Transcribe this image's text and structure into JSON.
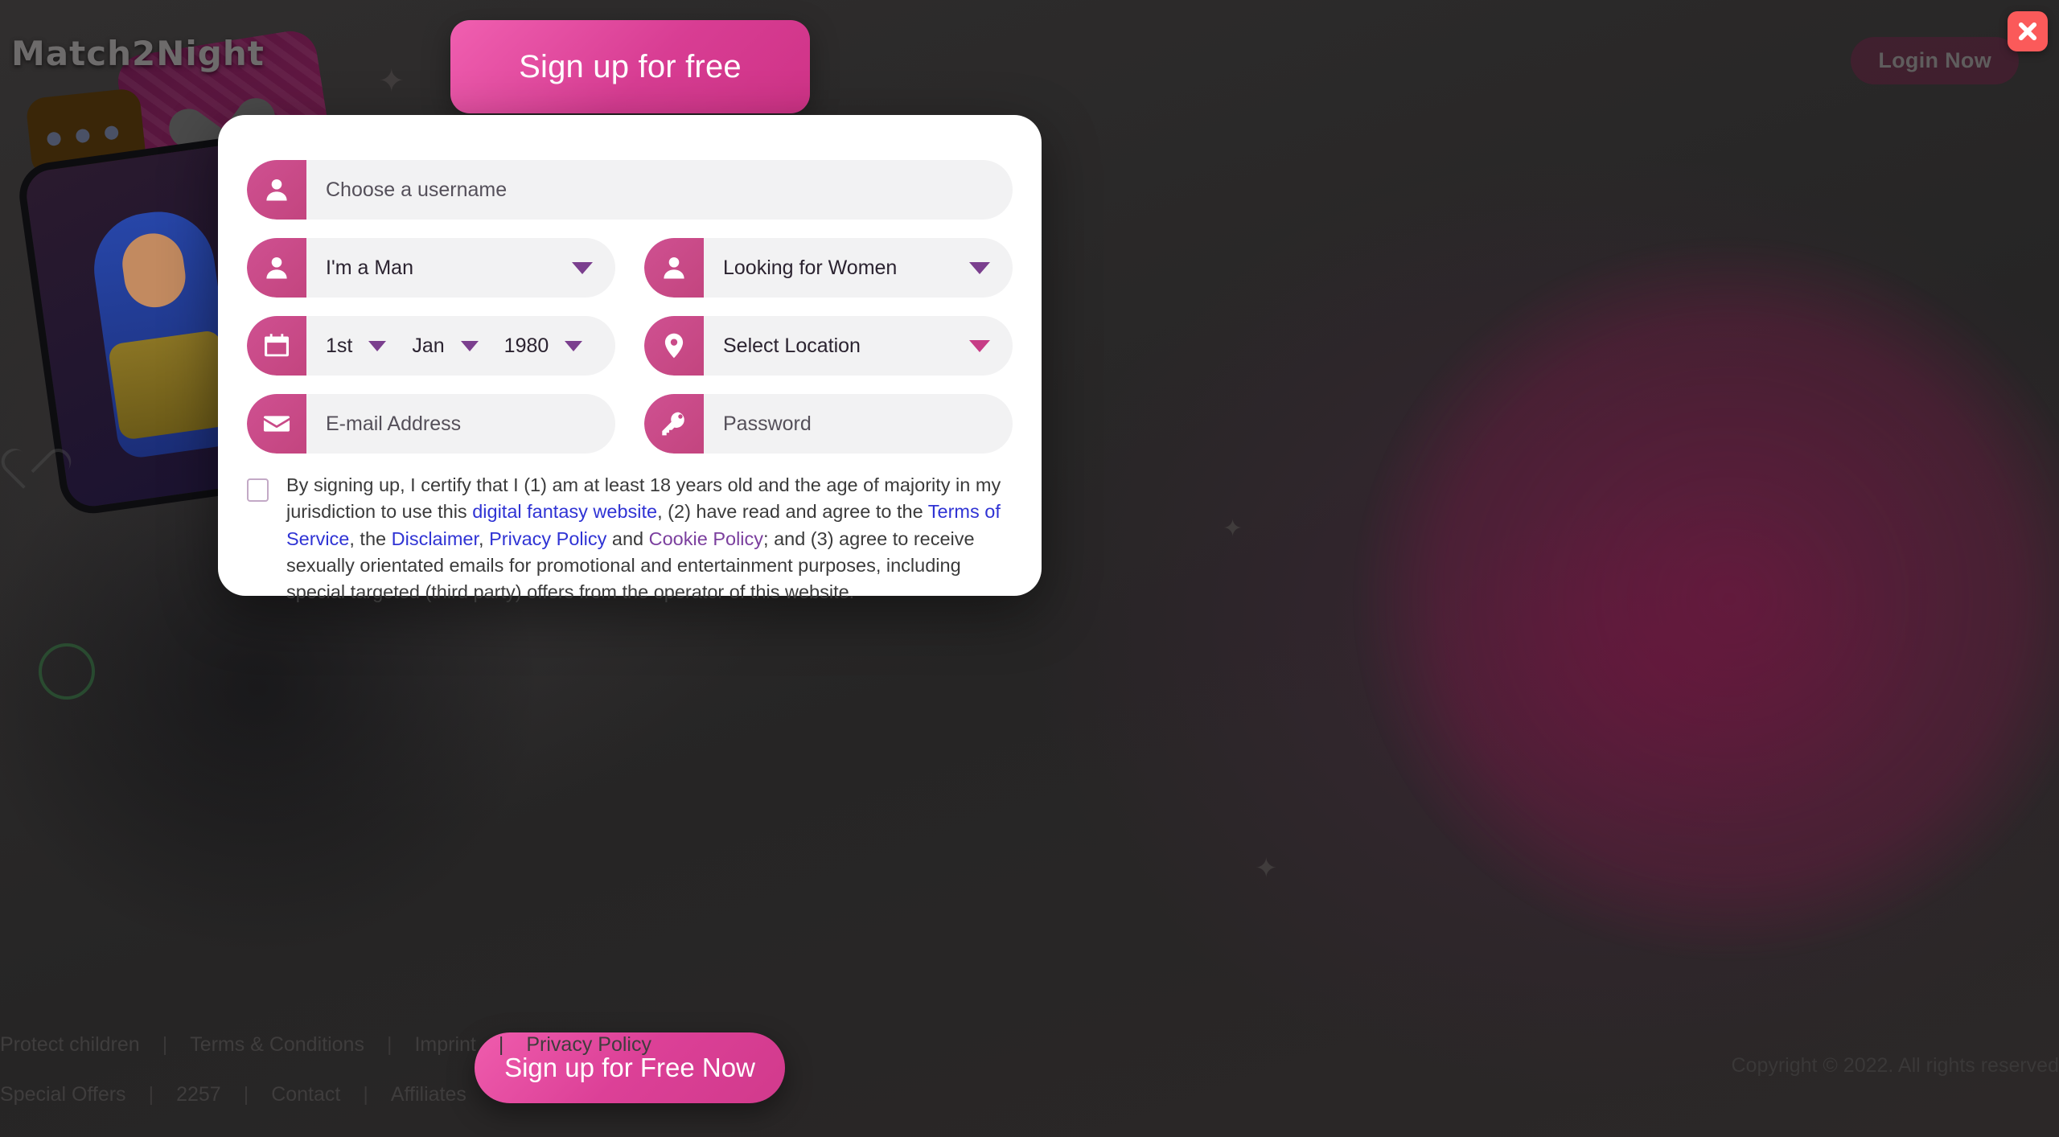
{
  "brand": {
    "logo_text": "Match2Night",
    "accent_pink": "#cf4a8c",
    "accent_purple": "#7b3f8e",
    "link_blue": "#2f33d4",
    "close_red": "#fb5a5a"
  },
  "header": {
    "login_label": "Login Now",
    "signup_top_label": "Sign up for free",
    "close_icon": "close-icon"
  },
  "form": {
    "username": {
      "icon": "person-icon",
      "placeholder": "Choose a username"
    },
    "gender": {
      "icon": "person-icon",
      "value": "I'm a Man",
      "caret": "chevron-down-icon"
    },
    "seeking": {
      "icon": "person-icon",
      "value": "Looking for Women",
      "caret": "chevron-down-icon"
    },
    "dob": {
      "icon": "calendar-icon",
      "day": "1st",
      "month": "Jan",
      "year": "1980"
    },
    "location": {
      "icon": "location-pin-icon",
      "value": "Select Location",
      "caret": "chevron-down-icon"
    },
    "email": {
      "icon": "envelope-icon",
      "placeholder": "E-mail Address"
    },
    "password": {
      "icon": "key-icon",
      "placeholder": "Password"
    }
  },
  "terms": {
    "checkbox_checked": false,
    "p1": "By signing up, I certify that I (1) am at least 18 years old and the age of majority in my jurisdiction to use this ",
    "link_fantasy": "digital fantasy website",
    "p2": ", (2) have read and agree to the ",
    "link_tos": "Terms of Service",
    "p3": ", the ",
    "link_disclaimer": "Disclaimer",
    "p4": ", ",
    "link_privacy": "Privacy Policy",
    "p5": " and ",
    "link_cookie": "Cookie Policy",
    "p6": "; and (3) agree to receive sexually orientated emails for promotional and entertainment purposes, including special targeted (third party) offers from the operator of this website."
  },
  "submit": {
    "label": "Sign up for Free Now"
  },
  "footer": {
    "row1": [
      "Protect children",
      "Terms & Conditions",
      "Imprint",
      "Privacy Policy"
    ],
    "row2": [
      "Special Offers",
      "2257",
      "Contact",
      "Affiliates"
    ],
    "separator": "|",
    "copyright": "Copyright © 2022. All rights reserved"
  }
}
